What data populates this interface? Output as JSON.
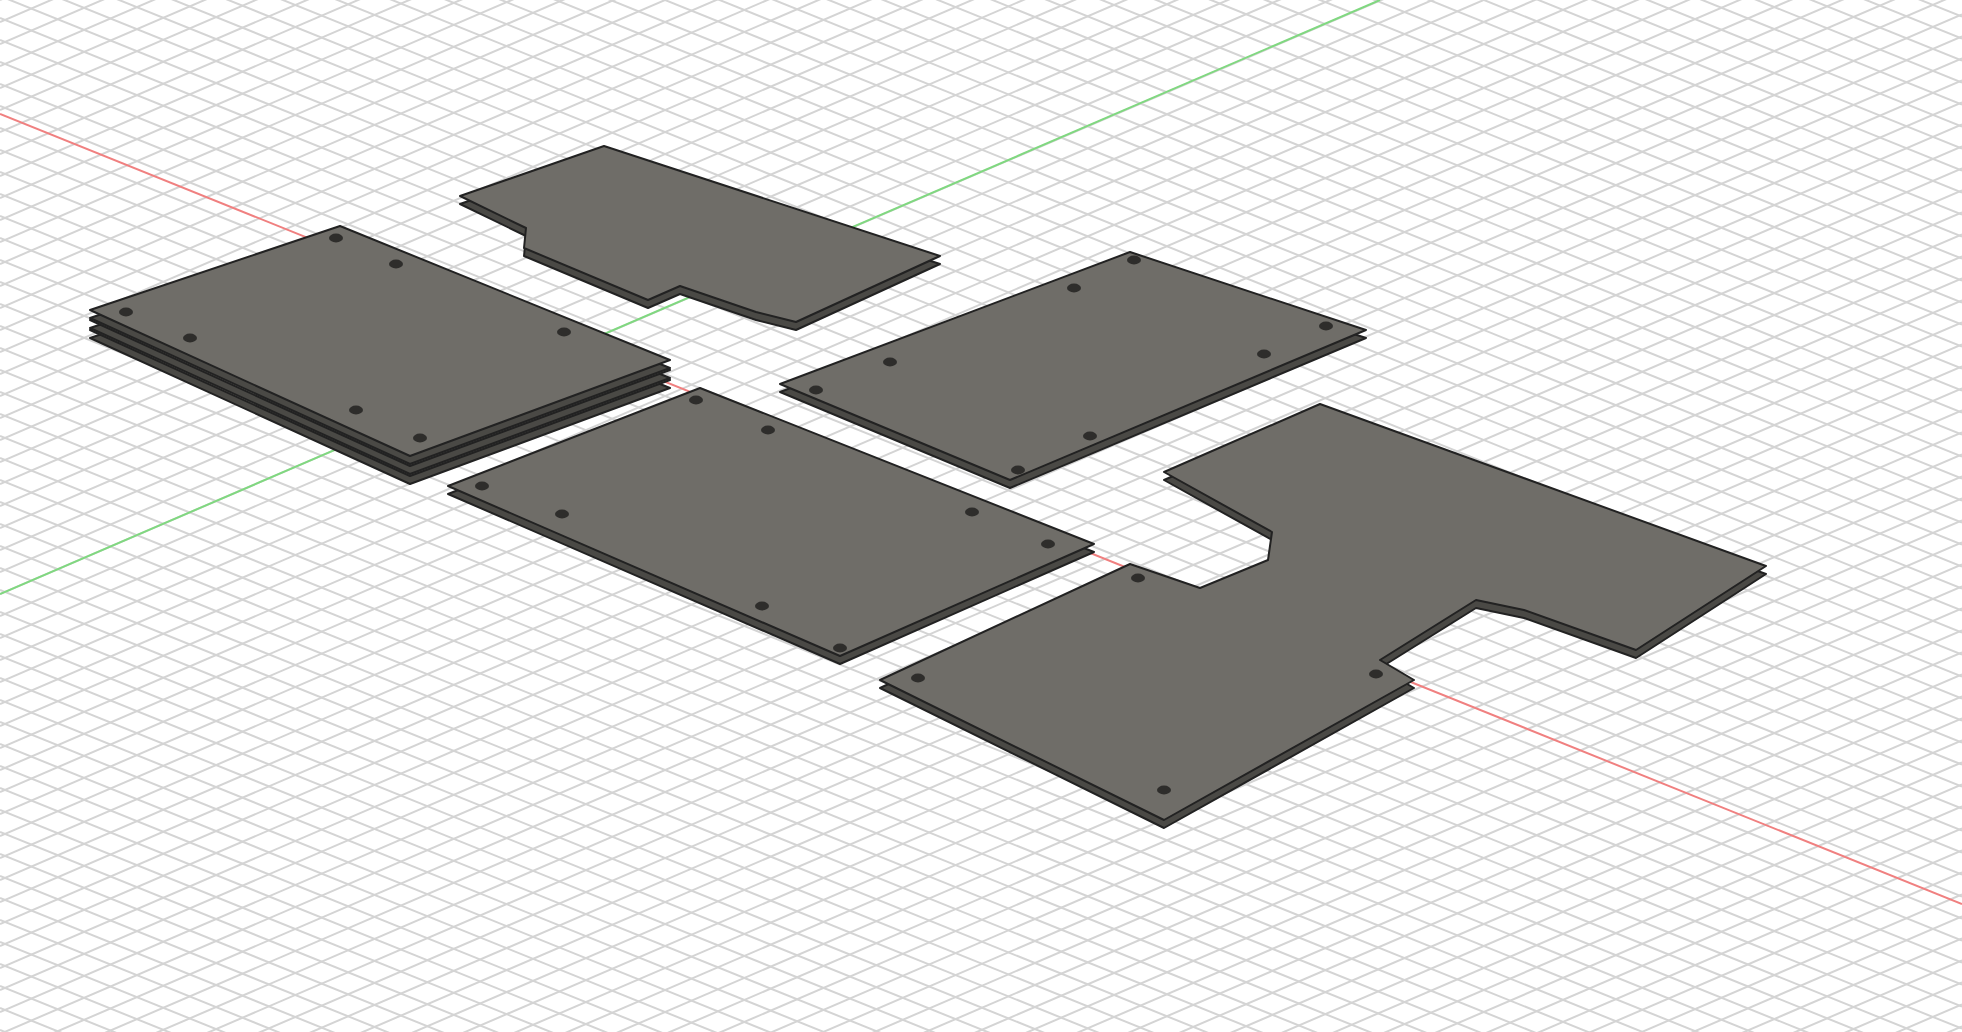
{
  "viewport": {
    "plates": [
      {
        "kind": "stacked"
      },
      {
        "kind": "single"
      },
      {
        "kind": "single"
      },
      {
        "kind": "single"
      },
      {
        "kind": "single"
      }
    ]
  }
}
